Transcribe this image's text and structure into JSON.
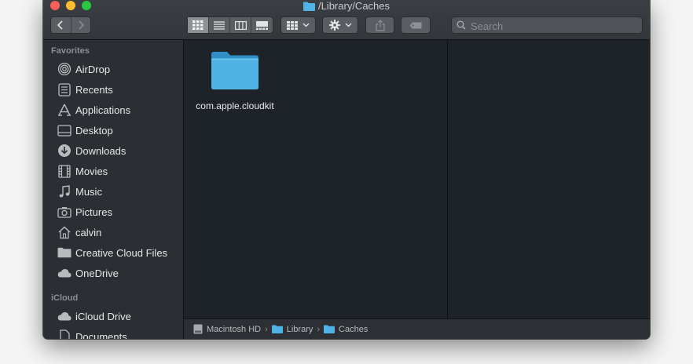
{
  "window": {
    "title": "/Library/Caches"
  },
  "toolbar": {
    "search_placeholder": "Search"
  },
  "sidebar": {
    "favorites_header": "Favorites",
    "favorites": [
      {
        "label": "AirDrop",
        "icon": "airdrop-icon"
      },
      {
        "label": "Recents",
        "icon": "recents-icon"
      },
      {
        "label": "Applications",
        "icon": "applications-icon"
      },
      {
        "label": "Desktop",
        "icon": "desktop-icon"
      },
      {
        "label": "Downloads",
        "icon": "downloads-icon"
      },
      {
        "label": "Movies",
        "icon": "movies-icon"
      },
      {
        "label": "Music",
        "icon": "music-icon"
      },
      {
        "label": "Pictures",
        "icon": "pictures-icon"
      },
      {
        "label": "calvin",
        "icon": "home-icon"
      },
      {
        "label": "Creative Cloud Files",
        "icon": "folder-icon"
      },
      {
        "label": "OneDrive",
        "icon": "cloud-icon"
      }
    ],
    "icloud_header": "iCloud",
    "icloud": [
      {
        "label": "iCloud Drive",
        "icon": "cloud-icon"
      },
      {
        "label": "Documents",
        "icon": "documents-icon"
      }
    ]
  },
  "content": {
    "items": [
      {
        "name": "com.apple.cloudkit",
        "icon": "folder-icon"
      }
    ]
  },
  "pathbar": {
    "crumbs": [
      {
        "label": "Macintosh HD",
        "icon": "disk-icon"
      },
      {
        "label": "Library",
        "icon": "folder-icon"
      },
      {
        "label": "Caches",
        "icon": "folder-icon"
      }
    ]
  },
  "colors": {
    "folder": "#4fb3e6",
    "accent": "#1d8fd6"
  }
}
